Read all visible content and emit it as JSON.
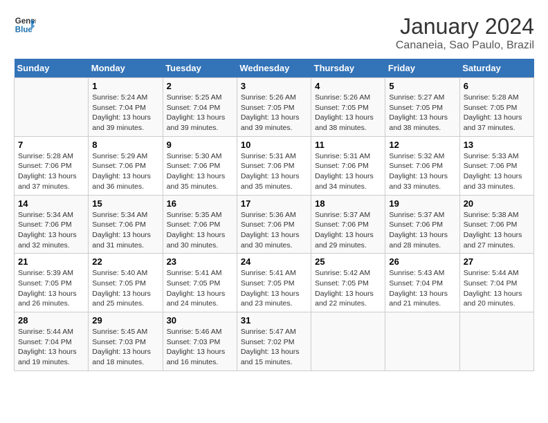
{
  "header": {
    "logo_line1": "General",
    "logo_line2": "Blue",
    "title": "January 2024",
    "subtitle": "Cananeia, Sao Paulo, Brazil"
  },
  "weekdays": [
    "Sunday",
    "Monday",
    "Tuesday",
    "Wednesday",
    "Thursday",
    "Friday",
    "Saturday"
  ],
  "weeks": [
    [
      {
        "day": "",
        "sunrise": "",
        "sunset": "",
        "daylight": ""
      },
      {
        "day": "1",
        "sunrise": "Sunrise: 5:24 AM",
        "sunset": "Sunset: 7:04 PM",
        "daylight": "Daylight: 13 hours and 39 minutes."
      },
      {
        "day": "2",
        "sunrise": "Sunrise: 5:25 AM",
        "sunset": "Sunset: 7:04 PM",
        "daylight": "Daylight: 13 hours and 39 minutes."
      },
      {
        "day": "3",
        "sunrise": "Sunrise: 5:26 AM",
        "sunset": "Sunset: 7:05 PM",
        "daylight": "Daylight: 13 hours and 39 minutes."
      },
      {
        "day": "4",
        "sunrise": "Sunrise: 5:26 AM",
        "sunset": "Sunset: 7:05 PM",
        "daylight": "Daylight: 13 hours and 38 minutes."
      },
      {
        "day": "5",
        "sunrise": "Sunrise: 5:27 AM",
        "sunset": "Sunset: 7:05 PM",
        "daylight": "Daylight: 13 hours and 38 minutes."
      },
      {
        "day": "6",
        "sunrise": "Sunrise: 5:28 AM",
        "sunset": "Sunset: 7:05 PM",
        "daylight": "Daylight: 13 hours and 37 minutes."
      }
    ],
    [
      {
        "day": "7",
        "sunrise": "Sunrise: 5:28 AM",
        "sunset": "Sunset: 7:06 PM",
        "daylight": "Daylight: 13 hours and 37 minutes."
      },
      {
        "day": "8",
        "sunrise": "Sunrise: 5:29 AM",
        "sunset": "Sunset: 7:06 PM",
        "daylight": "Daylight: 13 hours and 36 minutes."
      },
      {
        "day": "9",
        "sunrise": "Sunrise: 5:30 AM",
        "sunset": "Sunset: 7:06 PM",
        "daylight": "Daylight: 13 hours and 35 minutes."
      },
      {
        "day": "10",
        "sunrise": "Sunrise: 5:31 AM",
        "sunset": "Sunset: 7:06 PM",
        "daylight": "Daylight: 13 hours and 35 minutes."
      },
      {
        "day": "11",
        "sunrise": "Sunrise: 5:31 AM",
        "sunset": "Sunset: 7:06 PM",
        "daylight": "Daylight: 13 hours and 34 minutes."
      },
      {
        "day": "12",
        "sunrise": "Sunrise: 5:32 AM",
        "sunset": "Sunset: 7:06 PM",
        "daylight": "Daylight: 13 hours and 33 minutes."
      },
      {
        "day": "13",
        "sunrise": "Sunrise: 5:33 AM",
        "sunset": "Sunset: 7:06 PM",
        "daylight": "Daylight: 13 hours and 33 minutes."
      }
    ],
    [
      {
        "day": "14",
        "sunrise": "Sunrise: 5:34 AM",
        "sunset": "Sunset: 7:06 PM",
        "daylight": "Daylight: 13 hours and 32 minutes."
      },
      {
        "day": "15",
        "sunrise": "Sunrise: 5:34 AM",
        "sunset": "Sunset: 7:06 PM",
        "daylight": "Daylight: 13 hours and 31 minutes."
      },
      {
        "day": "16",
        "sunrise": "Sunrise: 5:35 AM",
        "sunset": "Sunset: 7:06 PM",
        "daylight": "Daylight: 13 hours and 30 minutes."
      },
      {
        "day": "17",
        "sunrise": "Sunrise: 5:36 AM",
        "sunset": "Sunset: 7:06 PM",
        "daylight": "Daylight: 13 hours and 30 minutes."
      },
      {
        "day": "18",
        "sunrise": "Sunrise: 5:37 AM",
        "sunset": "Sunset: 7:06 PM",
        "daylight": "Daylight: 13 hours and 29 minutes."
      },
      {
        "day": "19",
        "sunrise": "Sunrise: 5:37 AM",
        "sunset": "Sunset: 7:06 PM",
        "daylight": "Daylight: 13 hours and 28 minutes."
      },
      {
        "day": "20",
        "sunrise": "Sunrise: 5:38 AM",
        "sunset": "Sunset: 7:06 PM",
        "daylight": "Daylight: 13 hours and 27 minutes."
      }
    ],
    [
      {
        "day": "21",
        "sunrise": "Sunrise: 5:39 AM",
        "sunset": "Sunset: 7:05 PM",
        "daylight": "Daylight: 13 hours and 26 minutes."
      },
      {
        "day": "22",
        "sunrise": "Sunrise: 5:40 AM",
        "sunset": "Sunset: 7:05 PM",
        "daylight": "Daylight: 13 hours and 25 minutes."
      },
      {
        "day": "23",
        "sunrise": "Sunrise: 5:41 AM",
        "sunset": "Sunset: 7:05 PM",
        "daylight": "Daylight: 13 hours and 24 minutes."
      },
      {
        "day": "24",
        "sunrise": "Sunrise: 5:41 AM",
        "sunset": "Sunset: 7:05 PM",
        "daylight": "Daylight: 13 hours and 23 minutes."
      },
      {
        "day": "25",
        "sunrise": "Sunrise: 5:42 AM",
        "sunset": "Sunset: 7:05 PM",
        "daylight": "Daylight: 13 hours and 22 minutes."
      },
      {
        "day": "26",
        "sunrise": "Sunrise: 5:43 AM",
        "sunset": "Sunset: 7:04 PM",
        "daylight": "Daylight: 13 hours and 21 minutes."
      },
      {
        "day": "27",
        "sunrise": "Sunrise: 5:44 AM",
        "sunset": "Sunset: 7:04 PM",
        "daylight": "Daylight: 13 hours and 20 minutes."
      }
    ],
    [
      {
        "day": "28",
        "sunrise": "Sunrise: 5:44 AM",
        "sunset": "Sunset: 7:04 PM",
        "daylight": "Daylight: 13 hours and 19 minutes."
      },
      {
        "day": "29",
        "sunrise": "Sunrise: 5:45 AM",
        "sunset": "Sunset: 7:03 PM",
        "daylight": "Daylight: 13 hours and 18 minutes."
      },
      {
        "day": "30",
        "sunrise": "Sunrise: 5:46 AM",
        "sunset": "Sunset: 7:03 PM",
        "daylight": "Daylight: 13 hours and 16 minutes."
      },
      {
        "day": "31",
        "sunrise": "Sunrise: 5:47 AM",
        "sunset": "Sunset: 7:02 PM",
        "daylight": "Daylight: 13 hours and 15 minutes."
      },
      {
        "day": "",
        "sunrise": "",
        "sunset": "",
        "daylight": ""
      },
      {
        "day": "",
        "sunrise": "",
        "sunset": "",
        "daylight": ""
      },
      {
        "day": "",
        "sunrise": "",
        "sunset": "",
        "daylight": ""
      }
    ]
  ]
}
